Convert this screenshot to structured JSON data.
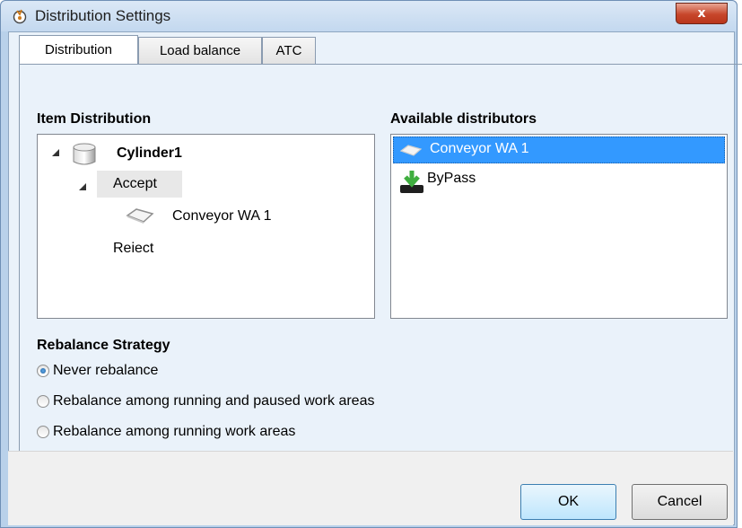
{
  "window": {
    "title": "Distribution Settings",
    "close_label": "x"
  },
  "tabs": [
    {
      "label": "Distribution",
      "active": true
    },
    {
      "label": "Load balance",
      "active": false
    },
    {
      "label": "ATC",
      "active": false
    }
  ],
  "item_distribution": {
    "label": "Item Distribution",
    "tree": {
      "root": {
        "label": "Cylinder1",
        "icon": "cylinder-icon"
      },
      "accept": {
        "label": "Accept"
      },
      "accept_child": {
        "label": "Conveyor WA 1",
        "icon": "conveyor-icon"
      },
      "reject": {
        "label": "Reiect"
      }
    }
  },
  "available_distributors": {
    "label": "Available distributors",
    "items": [
      {
        "label": "Conveyor WA 1",
        "icon": "conveyor-icon",
        "selected": true
      },
      {
        "label": "ByPass",
        "icon": "bypass-icon",
        "selected": false
      }
    ]
  },
  "rebalance": {
    "label": "Rebalance Strategy",
    "options": [
      {
        "label": "Never rebalance",
        "checked": true
      },
      {
        "label": "Rebalance among running and paused work areas",
        "checked": false
      },
      {
        "label": "Rebalance among running work areas",
        "checked": false
      }
    ]
  },
  "buttons": {
    "ok": "OK",
    "cancel": "Cancel"
  },
  "colors": {
    "selection": "#3399ff",
    "title_bg": "#c3d8ef",
    "close": "#c7462b"
  }
}
